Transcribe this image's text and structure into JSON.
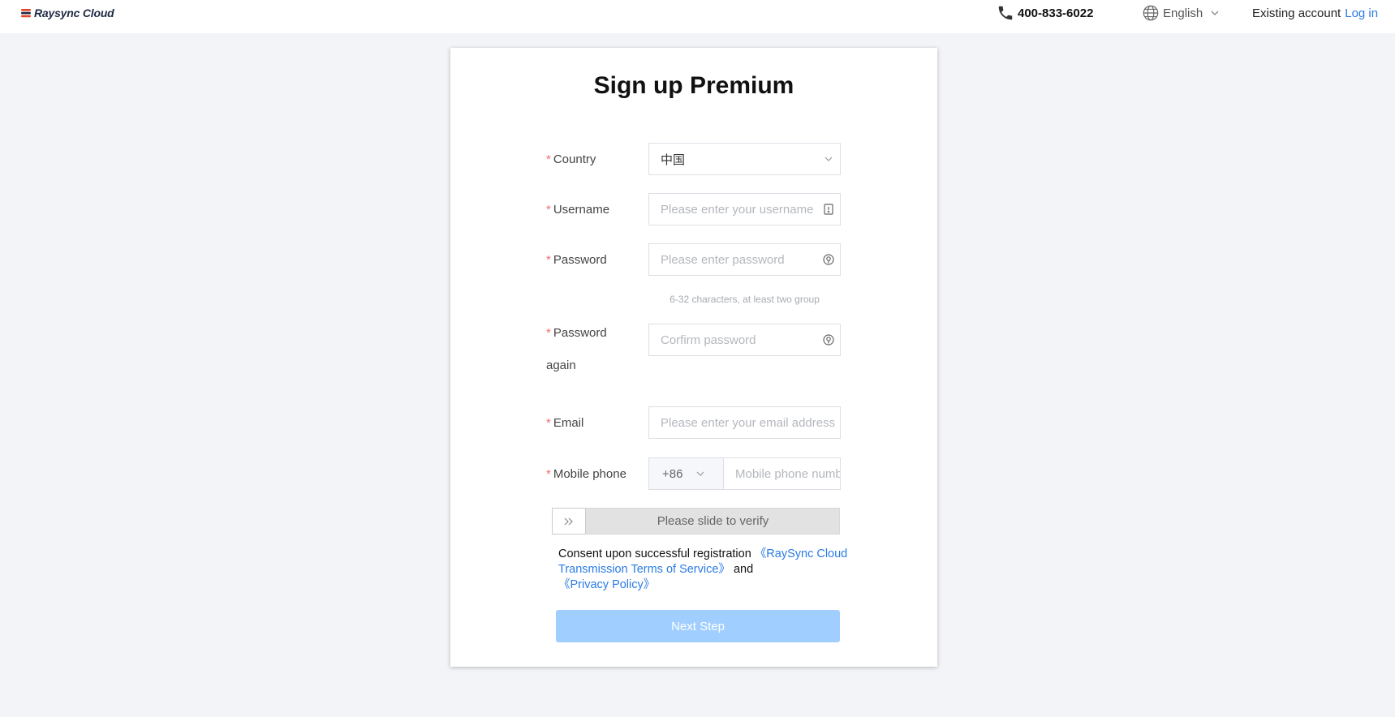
{
  "header": {
    "logo_text": "Raysync Cloud",
    "phone_number": "400-833-6022",
    "language": "English",
    "existing_account_text": "Existing account",
    "login_label": "Log in"
  },
  "form": {
    "title": "Sign up Premium",
    "required_mark": "*",
    "country": {
      "label": "Country",
      "value": "中国"
    },
    "username": {
      "label": "Username",
      "placeholder": "Please enter your username"
    },
    "password": {
      "label": "Password",
      "placeholder": "Please enter password",
      "hint": "6-32 characters, at least two group"
    },
    "password_again": {
      "label_line1": "Password",
      "label_line2": "again",
      "placeholder": "Corfirm password"
    },
    "email": {
      "label": "Email",
      "placeholder": "Please enter your email address"
    },
    "mobile": {
      "label": "Mobile phone",
      "code": "+86",
      "placeholder": "Mobile phone number"
    },
    "slider_text": "Please slide to verify",
    "consent": {
      "prefix": "Consent upon successful registration ",
      "terms_link": "《RaySync Cloud Transmission Terms of Service》",
      "and": " and ",
      "privacy_link": "《Privacy Policy》"
    },
    "next_button": "Next Step"
  },
  "colors": {
    "accent": "#2b7be4",
    "required": "#f56c6c",
    "button_disabled": "#a0cfff",
    "page_bg": "#f3f4f8"
  }
}
